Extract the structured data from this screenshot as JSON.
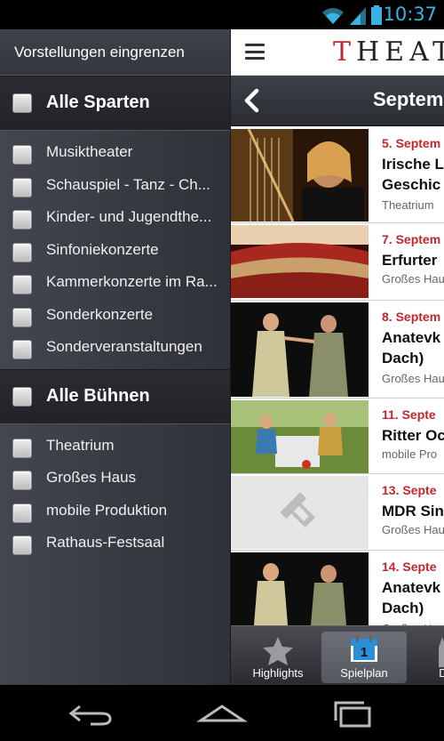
{
  "status_bar": {
    "time": "10:37",
    "icons": [
      "wifi-icon",
      "signal-icon",
      "battery-icon"
    ]
  },
  "drawer": {
    "header": "Vorstellungen eingrenzen",
    "sparten_section": {
      "label": "Alle Sparten",
      "items": [
        {
          "label": "Musiktheater"
        },
        {
          "label": "Schauspiel - Tanz - Ch..."
        },
        {
          "label": "Kinder- und Jugendthe..."
        },
        {
          "label": "Sinfoniekonzerte"
        },
        {
          "label": "Kammerkonzerte im Ra..."
        },
        {
          "label": "Sonderkonzerte"
        },
        {
          "label": "Sonderveranstaltungen"
        }
      ]
    },
    "buehnen_section": {
      "label": "Alle Bühnen",
      "items": [
        {
          "label": "Theatrium"
        },
        {
          "label": "Großes Haus"
        },
        {
          "label": "mobile Produktion"
        },
        {
          "label": "Rathaus-Festsaal"
        }
      ]
    }
  },
  "main": {
    "logo_first": "T",
    "logo_rest": "HEATE",
    "month_label": "Septem",
    "events": [
      {
        "date": "5. Septem",
        "title": "Irische L\nGeschic",
        "venue": "Theatrium"
      },
      {
        "date": "7. Septem",
        "title": "Erfurter",
        "venue": "Großes Hau"
      },
      {
        "date": "8. Septem",
        "title": "Anatevk\nDach)",
        "venue": "Großes Hau"
      },
      {
        "date": "11. Septe",
        "title": "Ritter Oc",
        "venue": "mobile Pro"
      },
      {
        "date": "13. Septe",
        "title": "MDR Sin",
        "venue": "Großes Hau"
      },
      {
        "date": "14. Septe",
        "title": "Anatevk\nDach)",
        "venue": "Großes Hau"
      }
    ]
  },
  "tabbar": {
    "tabs": [
      {
        "label": "Highlights",
        "icon": "star-icon"
      },
      {
        "label": "Spielplan",
        "icon": "calendar-icon",
        "badge": "1",
        "selected": true
      },
      {
        "label": "Dom",
        "icon": "cathedral-icon"
      }
    ]
  },
  "colors": {
    "accent_red": "#c2272d",
    "status_blue": "#39b3e4"
  }
}
